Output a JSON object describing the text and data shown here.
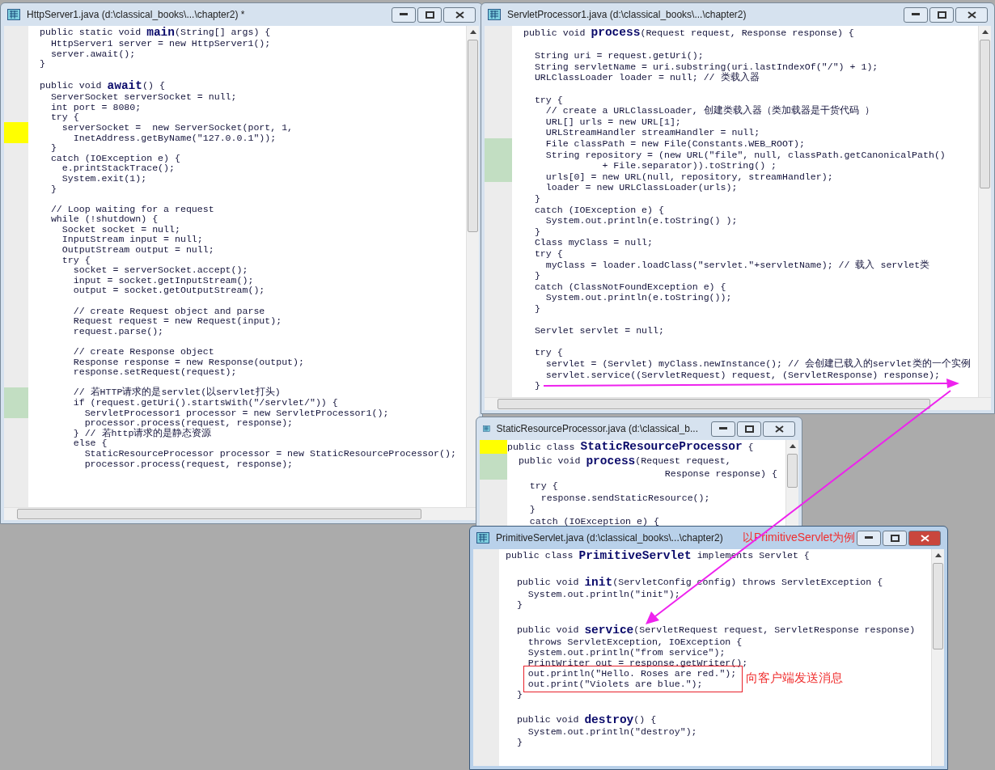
{
  "windows": [
    {
      "title": "HttpServer1.java (d:\\classical_books\\...\\chapter2) *",
      "active": false,
      "blocks": [
        [
          "public static void **main**(String[] args) {",
          "  HttpServer1 server = new HttpServer1();",
          "  server.await();",
          "}"
        ],
        [
          "public void **await**() {",
          "  ServerSocket serverSocket = null;",
          "  int port = 8080;",
          "  try {",
          {
            "text": "    serverSocket =  new ServerSocket(port, 1,",
            "color": "#ffff00"
          },
          {
            "text": "      InetAddress.getByName(\"127.0.0.1\"));",
            "color": "#ffff00"
          },
          "  }",
          "  catch (IOException e) {",
          "    e.printStackTrace();",
          "    System.exit(1);",
          "  }"
        ],
        [
          "  // Loop waiting for a request",
          "  while (!shutdown) {",
          "    Socket socket = null;",
          "    InputStream input = null;",
          "    OutputStream output = null;",
          "    try {",
          "      socket = serverSocket.accept();",
          "      input = socket.getInputStream();",
          "      output = socket.getOutputStream();"
        ],
        [
          "      // create Request object and parse",
          "      Request request = new Request(input);",
          "      request.parse();"
        ],
        [
          "      // create Response object",
          "      Response response = new Response(output);",
          "      response.setRequest(request);"
        ],
        [
          {
            "text": "      // 若HTTP请求的是servlet(以servlet打头)",
            "color": "#c2dec2"
          },
          {
            "text": "      if (request.getUri().startsWith(\"/servlet/\")) {",
            "color": "#c2dec2"
          },
          {
            "text": "        ServletProcessor1 processor = new ServletProcessor1();",
            "color": "#c2dec2"
          },
          "        processor.process(request, response);",
          "      } // 若http请求的是静态资源",
          "      else {",
          "        StaticResourceProcessor processor = new StaticResourceProcessor();",
          "        processor.process(request, response);"
        ]
      ]
    },
    {
      "title": "ServletProcessor1.java (d:\\classical_books\\...\\chapter2)",
      "active": false,
      "blocks": [
        [
          "public void **process**(Request request, Response response) {"
        ],
        [
          "  String uri = request.getUri();",
          "  String servletName = uri.substring(uri.lastIndexOf(\"/\") + 1);",
          "  URLClassLoader loader = null; // 类载入器"
        ],
        [
          "  try {",
          "    // create a URLClassLoader, 创建类载入器（类加载器是干货代码 ）",
          "    URL[] urls = new URL[1];",
          "    URLStreamHandler streamHandler = null;",
          {
            "text": "    File classPath = new File(Constants.WEB_ROOT);",
            "color": "#c2dec2"
          },
          {
            "text": "    String repository = (new URL(\"file\", null, classPath.getCanonicalPath()",
            "color": "#c2dec2"
          },
          {
            "text": "              + File.separator)).toString() ;",
            "color": "#c2dec2"
          },
          {
            "text": "    urls[0] = new URL(null, repository, streamHandler);",
            "color": "#c2dec2"
          },
          "    loader = new URLClassLoader(urls);",
          "  }",
          "  catch (IOException e) {",
          "    System.out.println(e.toString() );",
          "  }",
          "  Class myClass = null;",
          "  try {",
          "    myClass = loader.loadClass(\"servlet.\"+servletName); // 载入 servlet类",
          "  }",
          "  catch (ClassNotFoundException e) {",
          "    System.out.println(e.toString());",
          "  }"
        ],
        [
          "  Servlet servlet = null;"
        ],
        [
          "  try {",
          "    servlet = (Servlet) myClass.newInstance(); // 会创建已载入的servlet类的一个实例",
          "    servlet.service((ServletRequest) request, (ServletResponse) response);",
          "  }"
        ]
      ]
    },
    {
      "title": "StaticResourceProcessor.java (d:\\classical_b...",
      "active": false,
      "blocks": [
        [
          {
            "text": "public class **StaticResourceProcessor** {",
            "color": "#ffff00"
          },
          {
            "text": "  public void **process**(Request request,",
            "color": "#c2dec2"
          },
          {
            "text": "                            Response response) {",
            "color": "#c2dec2"
          },
          "    try {",
          "      response.sendStaticResource();",
          "    }",
          "    catch (IOException e) {"
        ]
      ]
    },
    {
      "title": "PrimitiveServlet.java (d:\\classical_books\\...\\chapter2)",
      "active": true,
      "blocks": [
        [
          "public class **PrimitiveServlet** implements Servlet {"
        ],
        [
          "  public void **init**(ServletConfig config) throws ServletException {",
          "    System.out.println(\"init\");",
          "  }"
        ],
        [
          "  public void **service**(ServletRequest request, ServletResponse response)",
          "    throws ServletException, IOException {",
          "    System.out.println(\"from service\");",
          "    PrintWriter out = response.getWriter();",
          {
            "text": "    out.println(\"Hello. Roses are red.\");",
            "boxed": true
          },
          {
            "text": "    out.print(\"Violets are blue.\");",
            "boxed": true
          },
          "  }"
        ],
        [
          "  public void **destroy**() {",
          "    System.out.println(\"destroy\");",
          "  }"
        ]
      ]
    }
  ],
  "annotations": [
    {
      "text": "以PrimitiveServlet为例"
    },
    {
      "text": "向客户端发送消息"
    }
  ]
}
